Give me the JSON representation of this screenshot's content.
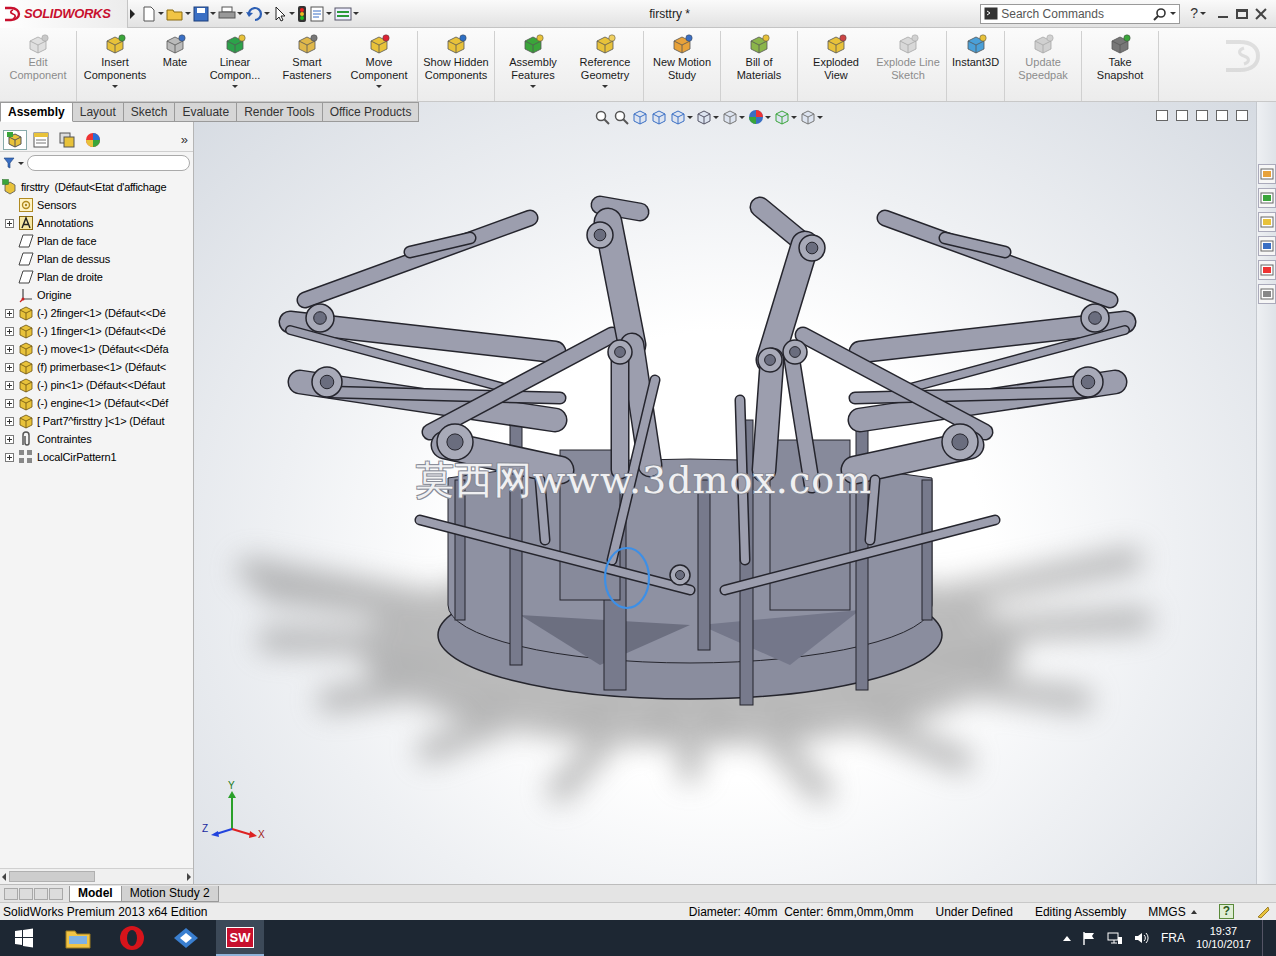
{
  "titlebar": {
    "logo": "SOLIDWORKS",
    "title": "firsttry *",
    "search_placeholder": "Search Commands",
    "help": "?"
  },
  "ribbon": {
    "groups": [
      [
        {
          "label": "Edit Component",
          "disabled": true,
          "dropdown": false
        }
      ],
      [
        {
          "label": "Insert Components",
          "disabled": false,
          "dropdown": true
        },
        {
          "label": "Mate",
          "disabled": false,
          "dropdown": false
        },
        {
          "label": "Linear Compon...",
          "disabled": false,
          "dropdown": true
        },
        {
          "label": "Smart Fasteners",
          "disabled": false,
          "dropdown": false
        },
        {
          "label": "Move Component",
          "disabled": false,
          "dropdown": true
        }
      ],
      [
        {
          "label": "Show Hidden Components",
          "disabled": false,
          "dropdown": false
        }
      ],
      [
        {
          "label": "Assembly Features",
          "disabled": false,
          "dropdown": true
        },
        {
          "label": "Reference Geometry",
          "disabled": false,
          "dropdown": true
        }
      ],
      [
        {
          "label": "New Motion Study",
          "disabled": false,
          "dropdown": false
        }
      ],
      [
        {
          "label": "Bill of Materials",
          "disabled": false,
          "dropdown": false
        }
      ],
      [
        {
          "label": "Exploded View",
          "disabled": false,
          "dropdown": false
        },
        {
          "label": "Explode Line Sketch",
          "disabled": true,
          "dropdown": false
        }
      ],
      [
        {
          "label": "Instant3D",
          "disabled": false,
          "dropdown": false
        }
      ],
      [
        {
          "label": "Update Speedpak",
          "disabled": true,
          "dropdown": false
        }
      ],
      [
        {
          "label": "Take Snapshot",
          "disabled": false,
          "dropdown": false
        }
      ]
    ]
  },
  "tabs": [
    {
      "label": "Assembly",
      "selected": true
    },
    {
      "label": "Layout",
      "selected": false
    },
    {
      "label": "Sketch",
      "selected": false
    },
    {
      "label": "Evaluate",
      "selected": false
    },
    {
      "label": "Render Tools",
      "selected": false
    },
    {
      "label": "Office Products",
      "selected": false
    }
  ],
  "feature_tree": {
    "more": "»",
    "items": [
      {
        "label": "firsttry  (Défaut<Etat d'affichage",
        "kind": "root",
        "expandable": false
      },
      {
        "label": "Sensors",
        "kind": "sensor",
        "expandable": false
      },
      {
        "label": "Annotations",
        "kind": "annotation",
        "expandable": true
      },
      {
        "label": "Plan de face",
        "kind": "plane",
        "expandable": false
      },
      {
        "label": "Plan de dessus",
        "kind": "plane",
        "expandable": false
      },
      {
        "label": "Plan de droite",
        "kind": "plane",
        "expandable": false
      },
      {
        "label": "Origine",
        "kind": "origin",
        "expandable": false
      },
      {
        "label": "(-) 2finger<1> (Défaut<<Dé",
        "kind": "part",
        "expandable": true
      },
      {
        "label": "(-) 1finger<1> (Défaut<<Dé",
        "kind": "part",
        "expandable": true
      },
      {
        "label": "(-) move<1> (Défaut<<Défa",
        "kind": "part",
        "expandable": true
      },
      {
        "label": "(f) primerbase<1> (Défaut<",
        "kind": "part",
        "expandable": true
      },
      {
        "label": "(-) pin<1> (Défaut<<Défaut",
        "kind": "part",
        "expandable": true
      },
      {
        "label": "(-) engine<1> (Défaut<<Déf",
        "kind": "part",
        "expandable": true
      },
      {
        "label": "[ Part7^firsttry ]<1> (Défaut",
        "kind": "part",
        "expandable": true
      },
      {
        "label": "Contraintes",
        "kind": "mates",
        "expandable": true
      },
      {
        "label": "LocalCirPattern1",
        "kind": "pattern",
        "expandable": true
      }
    ]
  },
  "viewport": {
    "watermark": "莫西网www.3dmox.com",
    "axes": {
      "y": "Y",
      "z": "Z",
      "x": "X"
    }
  },
  "bottom_tabs": [
    {
      "label": "Model",
      "selected": true
    },
    {
      "label": "Motion Study 2",
      "selected": false
    }
  ],
  "status_bar": {
    "edition": "SolidWorks Premium 2013 x64 Edition",
    "measurement": "Diameter: 40mm  Center: 6mm,0mm,0mm",
    "definition": "Under Defined",
    "mode": "Editing Assembly",
    "units": "MMGS",
    "help": "?"
  },
  "taskbar": {
    "apps": [
      {
        "kind": "start",
        "active": false
      },
      {
        "kind": "explorer",
        "active": false
      },
      {
        "kind": "opera",
        "active": false
      },
      {
        "kind": "app",
        "active": false
      },
      {
        "kind": "solidworks",
        "active": true
      }
    ],
    "sw_label": "SW",
    "language": "FRA",
    "time": "19:37",
    "date": "10/10/2017"
  }
}
